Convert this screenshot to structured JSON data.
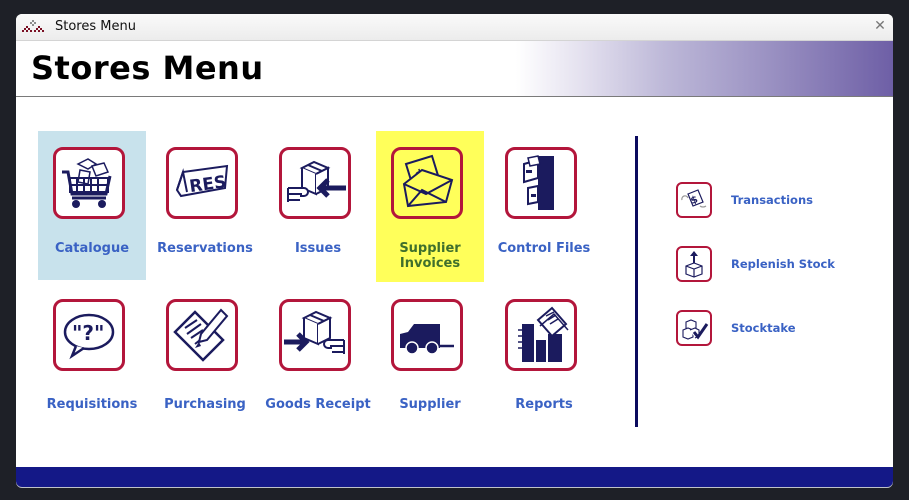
{
  "window": {
    "title": "Stores Menu",
    "close_symbol": "✕",
    "app_icon": "diamond-dots-logo-icon"
  },
  "header": {
    "title": "Stores Menu"
  },
  "tiles": [
    {
      "label": "Catalogue",
      "icon": "shopping-cart-icon",
      "state": "selected"
    },
    {
      "label": "Reservations",
      "icon": "res-sign-icon",
      "state": "normal"
    },
    {
      "label": "Issues",
      "icon": "box-hand-arrow-in-icon",
      "state": "normal"
    },
    {
      "label": "Supplier Invoices",
      "icon": "invoice-envelope-icon",
      "state": "highlighted"
    },
    {
      "label": "Control Files",
      "icon": "filing-cabinet-icon",
      "state": "normal"
    },
    {
      "label": "Requisitions",
      "icon": "question-bubble-icon",
      "state": "normal"
    },
    {
      "label": "Purchasing",
      "icon": "document-pen-icon",
      "state": "normal"
    },
    {
      "label": "Goods Receipt",
      "icon": "arrow-box-hand-icon",
      "state": "normal"
    },
    {
      "label": "Supplier",
      "icon": "truck-icon",
      "state": "normal"
    },
    {
      "label": "Reports",
      "icon": "reports-chart-icon",
      "state": "normal"
    }
  ],
  "tile_line2": {
    "supplier_invoices_line1": "Supplier",
    "supplier_invoices_line2": "Invoices"
  },
  "side_links": [
    {
      "label": "Transactions",
      "icon": "money-transaction-icon"
    },
    {
      "label": "Replenish Stock",
      "icon": "box-arrow-up-icon"
    },
    {
      "label": "Stocktake",
      "icon": "boxes-check-icon"
    }
  ],
  "colors": {
    "accent_blue": "#3a62c4",
    "icon_border": "#b3163b",
    "icon_navy": "#1b1b5e",
    "selected_bg": "#c8e2ec",
    "highlight_bg": "#ffff5a",
    "footer": "#141887"
  }
}
